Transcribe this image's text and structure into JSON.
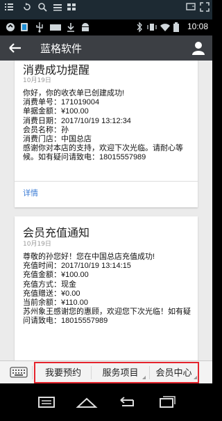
{
  "status_bar": {
    "time": "10:08"
  },
  "app_bar": {
    "title": "蓝格软件"
  },
  "cards": [
    {
      "title": "消费成功提醒",
      "date": "10月19日",
      "lines": [
        "你好，你的收衣单已创建成功!",
        "消费单号：171019004",
        "单据金额：¥100.00",
        "消费日期：2017/10/19 13:12:34",
        "会员名称：孙",
        "消费门店：中国总店",
        "感谢你对本店的支持，欢迎下次光临。请耐心等候。如有疑问请致电：18015557989"
      ],
      "link": "详情"
    },
    {
      "title": "会员充值通知",
      "date": "10月19日",
      "lines": [
        "尊敬的孙您好！您在中国总店充值成功!",
        "充值时间：2017/10/19 13:14:15",
        "充值金额：¥100.00",
        "充值方式：现金",
        "充值赠送：¥0.00",
        "当前余额：¥110.00",
        "苏州象王感谢您的惠顾，欢迎您下次光临！如有疑问请致电：18015557989"
      ]
    }
  ],
  "menu": {
    "items": [
      "我要预约",
      "服务项目",
      "会员中心"
    ]
  },
  "icons": {
    "back": "arrow-left-icon",
    "user": "user-icon",
    "keyboard": "keyboard-icon"
  },
  "colors": {
    "app_bar": "#3c3f44",
    "highlight": "#e5242d",
    "link": "#3a7bd5"
  }
}
